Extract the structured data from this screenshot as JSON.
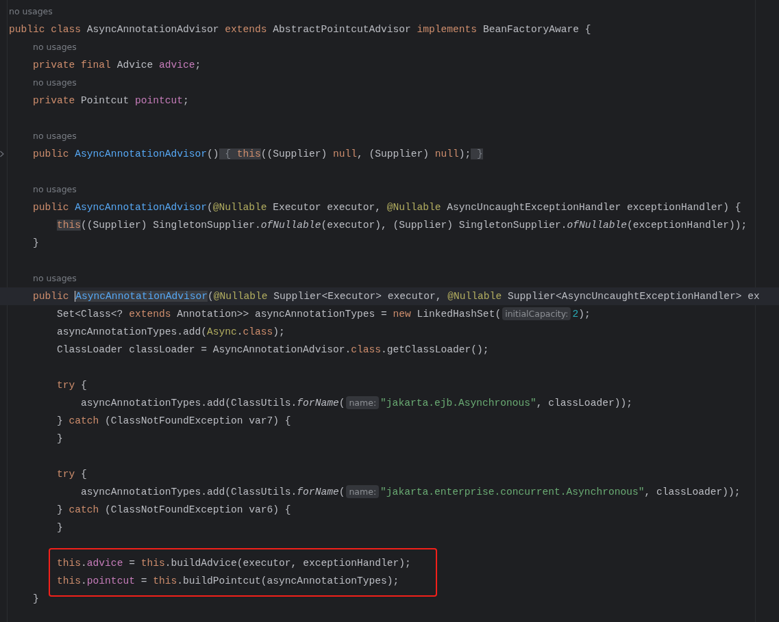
{
  "editor": {
    "lines": [
      {
        "kind": "usage",
        "text": "no usages"
      },
      {
        "kind": "code",
        "tokens": [
          {
            "kind": "keyword",
            "text": "public class "
          },
          {
            "kind": "plain",
            "text": "AsyncAnnotationAdvisor "
          },
          {
            "kind": "keyword",
            "text": "extends "
          },
          {
            "kind": "plain",
            "text": "AbstractPointcutAdvisor "
          },
          {
            "kind": "keyword",
            "text": "implements "
          },
          {
            "kind": "plain",
            "text": "BeanFactoryAware {"
          }
        ],
        "children": [
          {
            "kind": "usage",
            "text": "no usages"
          },
          {
            "kind": "code",
            "tokens": [
              {
                "kind": "keyword",
                "text": "private final "
              },
              {
                "kind": "plain",
                "text": "Advice "
              },
              {
                "kind": "field",
                "text": "advice"
              },
              {
                "kind": "plain",
                "text": ";"
              }
            ]
          },
          {
            "kind": "usage",
            "text": "no usages"
          },
          {
            "kind": "code",
            "tokens": [
              {
                "kind": "keyword",
                "text": "private "
              },
              {
                "kind": "plain",
                "text": "Pointcut "
              },
              {
                "kind": "field",
                "text": "pointcut"
              },
              {
                "kind": "plain",
                "text": ";"
              }
            ]
          },
          {
            "kind": "blank"
          },
          {
            "kind": "usage",
            "text": "no usages"
          },
          {
            "kind": "folded",
            "tokens": [
              {
                "kind": "keyword",
                "text": "public "
              },
              {
                "kind": "declaration",
                "text": "AsyncAnnotationAdvisor"
              },
              {
                "kind": "plain",
                "text": "()"
              },
              {
                "kind": "fold-brace",
                "text": " { "
              },
              {
                "kind": "keyword-marked",
                "text": "this"
              },
              {
                "kind": "plain",
                "text": "((Supplier) "
              },
              {
                "kind": "keyword",
                "text": "null"
              },
              {
                "kind": "plain",
                "text": ", (Supplier) "
              },
              {
                "kind": "keyword",
                "text": "null"
              },
              {
                "kind": "plain",
                "text": ");"
              },
              {
                "kind": "fold-brace",
                "text": " }"
              }
            ]
          },
          {
            "kind": "blank"
          },
          {
            "kind": "usage",
            "text": "no usages"
          },
          {
            "kind": "code",
            "tokens": [
              {
                "kind": "keyword",
                "text": "public "
              },
              {
                "kind": "declaration",
                "text": "AsyncAnnotationAdvisor"
              },
              {
                "kind": "plain",
                "text": "("
              },
              {
                "kind": "annotation",
                "text": "@Nullable"
              },
              {
                "kind": "plain",
                "text": " Executor executor, "
              },
              {
                "kind": "annotation",
                "text": "@Nullable"
              },
              {
                "kind": "plain",
                "text": " AsyncUncaughtExceptionHandler exceptionHandler) {"
              }
            ],
            "children": [
              {
                "kind": "code",
                "tokens": [
                  {
                    "kind": "keyword-marked",
                    "text": "this"
                  },
                  {
                    "kind": "plain",
                    "text": "((Supplier) SingletonSupplier."
                  },
                  {
                    "kind": "static-call",
                    "text": "ofNullable"
                  },
                  {
                    "kind": "plain",
                    "text": "(executor), (Supplier) SingletonSupplier."
                  },
                  {
                    "kind": "static-call",
                    "text": "ofNullable"
                  },
                  {
                    "kind": "plain",
                    "text": "(exceptionHandler));"
                  }
                ]
              }
            ]
          },
          {
            "kind": "code",
            "tokens": [
              {
                "kind": "plain",
                "text": "}"
              }
            ]
          },
          {
            "kind": "blank"
          },
          {
            "kind": "usage",
            "text": "no usages"
          },
          {
            "kind": "current",
            "tokens": [
              {
                "kind": "keyword",
                "text": "public "
              },
              {
                "kind": "declaration-marked",
                "text": "AsyncAnnotationAdvisor"
              },
              {
                "kind": "plain",
                "text": "("
              },
              {
                "kind": "annotation",
                "text": "@Nullable"
              },
              {
                "kind": "plain",
                "text": " Supplier<Executor> executor, "
              },
              {
                "kind": "annotation",
                "text": "@Nullable"
              },
              {
                "kind": "plain",
                "text": " Supplier<AsyncUncaughtExceptionHandler> ex"
              }
            ],
            "children": [
              {
                "kind": "code",
                "tokens": [
                  {
                    "kind": "plain",
                    "text": "Set<Class<? "
                  },
                  {
                    "kind": "keyword",
                    "text": "extends"
                  },
                  {
                    "kind": "plain",
                    "text": " Annotation>> asyncAnnotationTypes = "
                  },
                  {
                    "kind": "keyword",
                    "text": "new"
                  },
                  {
                    "kind": "plain",
                    "text": " LinkedHashSet("
                  },
                  {
                    "kind": "hint",
                    "text": "initialCapacity:"
                  },
                  {
                    "kind": "number",
                    "text": "2"
                  },
                  {
                    "kind": "plain",
                    "text": ");"
                  }
                ]
              },
              {
                "kind": "code",
                "tokens": [
                  {
                    "kind": "plain",
                    "text": "asyncAnnotationTypes.add("
                  },
                  {
                    "kind": "annotation",
                    "text": "Async"
                  },
                  {
                    "kind": "plain",
                    "text": "."
                  },
                  {
                    "kind": "keyword",
                    "text": "class"
                  },
                  {
                    "kind": "plain",
                    "text": ");"
                  }
                ]
              },
              {
                "kind": "code",
                "tokens": [
                  {
                    "kind": "plain",
                    "text": "ClassLoader classLoader = AsyncAnnotationAdvisor."
                  },
                  {
                    "kind": "keyword",
                    "text": "class"
                  },
                  {
                    "kind": "plain",
                    "text": ".getClassLoader();"
                  }
                ]
              },
              {
                "kind": "blank"
              },
              {
                "kind": "code",
                "tokens": [
                  {
                    "kind": "keyword",
                    "text": "try"
                  },
                  {
                    "kind": "plain",
                    "text": " {"
                  }
                ],
                "children": [
                  {
                    "kind": "code",
                    "tokens": [
                      {
                        "kind": "plain",
                        "text": "asyncAnnotationTypes.add(ClassUtils."
                      },
                      {
                        "kind": "static-call",
                        "text": "forName"
                      },
                      {
                        "kind": "plain",
                        "text": "("
                      },
                      {
                        "kind": "hint",
                        "text": "name:"
                      },
                      {
                        "kind": "string",
                        "text": "\"jakarta.ejb.Asynchronous\""
                      },
                      {
                        "kind": "plain",
                        "text": ", classLoader));"
                      }
                    ]
                  }
                ]
              },
              {
                "kind": "code",
                "tokens": [
                  {
                    "kind": "plain",
                    "text": "} "
                  },
                  {
                    "kind": "keyword",
                    "text": "catch"
                  },
                  {
                    "kind": "plain",
                    "text": " (ClassNotFoundException var7) {"
                  }
                ]
              },
              {
                "kind": "code",
                "tokens": [
                  {
                    "kind": "plain",
                    "text": "}"
                  }
                ]
              },
              {
                "kind": "blank"
              },
              {
                "kind": "code",
                "tokens": [
                  {
                    "kind": "keyword",
                    "text": "try"
                  },
                  {
                    "kind": "plain",
                    "text": " {"
                  }
                ],
                "children": [
                  {
                    "kind": "code",
                    "tokens": [
                      {
                        "kind": "plain",
                        "text": "asyncAnnotationTypes.add(ClassUtils."
                      },
                      {
                        "kind": "static-call",
                        "text": "forName"
                      },
                      {
                        "kind": "plain",
                        "text": "("
                      },
                      {
                        "kind": "hint",
                        "text": "name:"
                      },
                      {
                        "kind": "string",
                        "text": "\"jakarta.enterprise.concurrent.Asynchronous\""
                      },
                      {
                        "kind": "plain",
                        "text": ", classLoader));"
                      }
                    ]
                  }
                ]
              },
              {
                "kind": "code",
                "tokens": [
                  {
                    "kind": "plain",
                    "text": "} "
                  },
                  {
                    "kind": "keyword",
                    "text": "catch"
                  },
                  {
                    "kind": "plain",
                    "text": " (ClassNotFoundException var6) {"
                  }
                ]
              },
              {
                "kind": "code",
                "tokens": [
                  {
                    "kind": "plain",
                    "text": "}"
                  }
                ]
              },
              {
                "kind": "blank"
              },
              {
                "kind": "box",
                "lines": [
                  {
                    "kind": "code",
                    "tokens": [
                      {
                        "kind": "keyword",
                        "text": "this"
                      },
                      {
                        "kind": "plain",
                        "text": "."
                      },
                      {
                        "kind": "field",
                        "text": "advice"
                      },
                      {
                        "kind": "plain",
                        "text": " = "
                      },
                      {
                        "kind": "keyword",
                        "text": "this"
                      },
                      {
                        "kind": "plain",
                        "text": ".buildAdvice(executor, exceptionHandler);"
                      }
                    ]
                  },
                  {
                    "kind": "code",
                    "tokens": [
                      {
                        "kind": "keyword",
                        "text": "this"
                      },
                      {
                        "kind": "plain",
                        "text": "."
                      },
                      {
                        "kind": "field",
                        "text": "pointcut"
                      },
                      {
                        "kind": "plain",
                        "text": " = "
                      },
                      {
                        "kind": "keyword",
                        "text": "this"
                      },
                      {
                        "kind": "plain",
                        "text": ".buildPointcut(asyncAnnotationTypes);"
                      }
                    ]
                  }
                ]
              }
            ]
          },
          {
            "kind": "code",
            "tokens": [
              {
                "kind": "plain",
                "text": "}"
              }
            ]
          }
        ]
      }
    ]
  }
}
